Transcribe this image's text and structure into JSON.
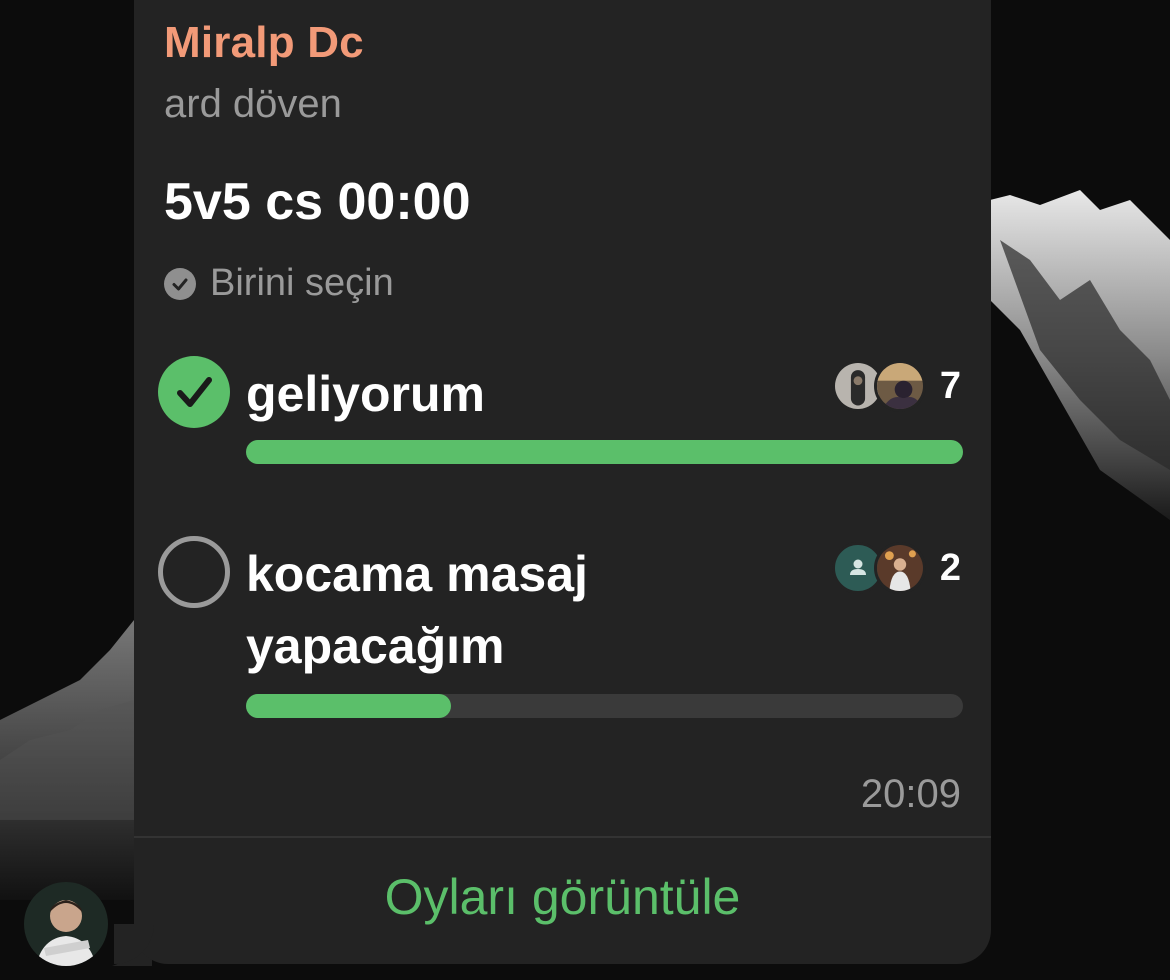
{
  "message": {
    "sender_name": "Miralp Dc",
    "subtitle": "ard döven",
    "timestamp": "20:09"
  },
  "poll": {
    "question": "5v5 cs 00:00",
    "type_label": "Birini seçin",
    "view_votes_label": "Oyları görüntüle",
    "options": [
      {
        "text": "geliyorum",
        "votes": "7",
        "selected": true,
        "fill_fraction": 1.0
      },
      {
        "text_line1": "kocama masaj",
        "text_line2": "yapacağım",
        "votes": "2",
        "selected": false,
        "fill_fraction": 0.286
      }
    ]
  },
  "colors": {
    "accent_green": "#5bbf6a",
    "sender_name": "#f29a78",
    "bubble_bg": "#232323",
    "secondary_text": "#9a9a9a"
  },
  "icons": [
    "check-icon",
    "check-circle-icon",
    "person-icon",
    "avatar"
  ]
}
